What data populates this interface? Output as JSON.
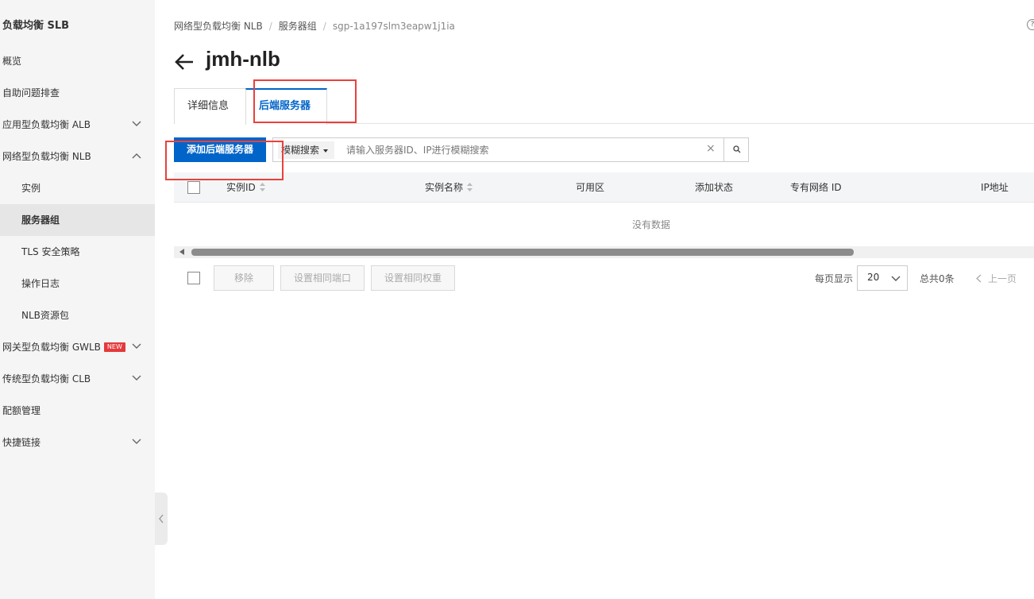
{
  "sidebar": {
    "title": "负载均衡 SLB",
    "items": [
      {
        "label": "概览"
      },
      {
        "label": "自助问题排查"
      },
      {
        "label": "应用型负载均衡 ALB"
      },
      {
        "label": "网络型负载均衡 NLB"
      },
      {
        "label": "实例"
      },
      {
        "label": "服务器组"
      },
      {
        "label": "TLS 安全策略"
      },
      {
        "label": "操作日志"
      },
      {
        "label": "NLB资源包"
      },
      {
        "label": "网关型负载均衡 GWLB",
        "badge": "NEW"
      },
      {
        "label": "传统型负载均衡 CLB"
      },
      {
        "label": "配额管理"
      },
      {
        "label": "快捷链接"
      }
    ]
  },
  "breadcrumb": [
    "网络型负载均衡 NLB",
    "服务器组",
    "sgp-1a197slm3eapw1j1ia"
  ],
  "help_icon": "?",
  "page_title": "jmh-nlb",
  "tabs": [
    {
      "label": "详细信息"
    },
    {
      "label": "后端服务器"
    }
  ],
  "toolbar": {
    "add_button": "添加后端服务器",
    "search_type": "模糊搜索",
    "search_placeholder": "请输入服务器ID、IP进行模糊搜索"
  },
  "table": {
    "columns": [
      "实例ID",
      "实例名称",
      "可用区",
      "添加状态",
      "专有网络 ID",
      "IP地址"
    ],
    "empty_text": "没有数据"
  },
  "footer": {
    "remove_button": "移除",
    "set_port_button": "设置相同端口",
    "set_weight_button": "设置相同权重",
    "page_size_label": "每页显示",
    "page_size": "20",
    "total": "总共0条",
    "prev_page": "上一页"
  },
  "colors": {
    "accent": "#0064c8",
    "annotation": "#e8413c",
    "brand_orange": "#ff6a00"
  }
}
